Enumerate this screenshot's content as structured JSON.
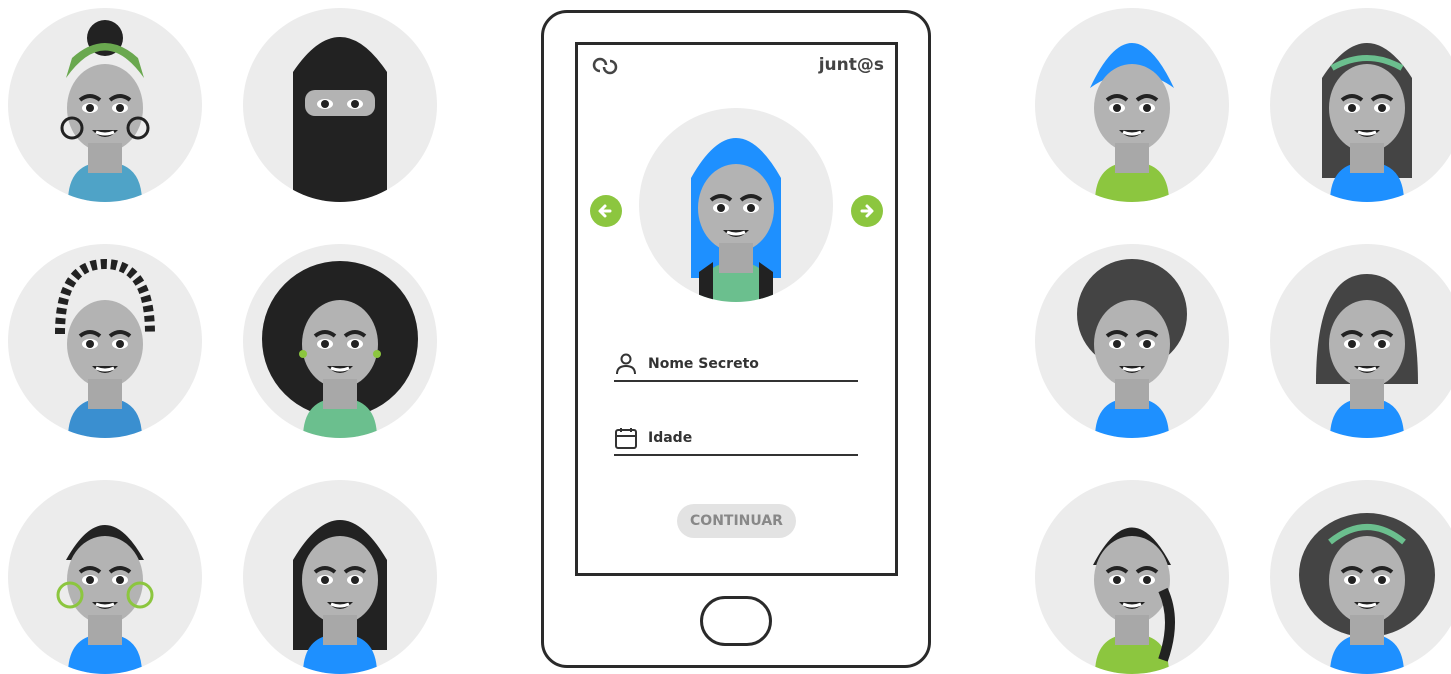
{
  "app": {
    "brand_name": "junt@s",
    "logo_icon": "swirl-logo-icon"
  },
  "form": {
    "name_label": "Nome Secreto",
    "name_icon": "user-icon",
    "age_label": "Idade",
    "age_icon": "calendar-icon",
    "continue_label": "CONTINUAR"
  },
  "avatar_picker": {
    "prev_icon": "arrow-left-icon",
    "next_icon": "arrow-right-icon"
  },
  "colors": {
    "accent_green": "#8cc63f",
    "accent_blue": "#1e90ff",
    "outline": "#2a2a2a",
    "avatar_bg": "#ececec",
    "button_bg": "#e3e3e3"
  }
}
